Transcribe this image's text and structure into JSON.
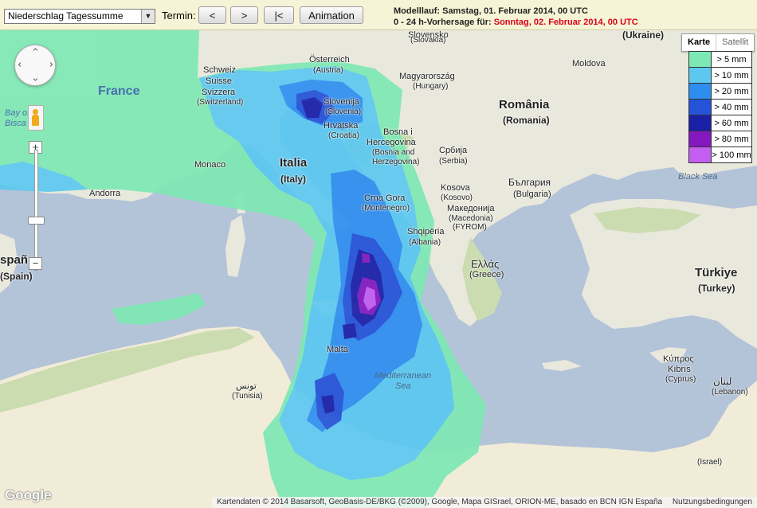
{
  "toolbar": {
    "product_select": "Niederschlag Tagessumme",
    "termin_label": "Termin:",
    "prev_button": "<",
    "next_button": ">",
    "first_button": "|<",
    "animation_button": "Animation",
    "modellauf_label": "Modelllauf: Samstag, 01. Februar 2014, 00 UTC",
    "forecast_prefix": "0 - 24 h-Vorhersage für:",
    "forecast_date": "Sonntag, 02. Februar 2014, 00 UTC",
    "colors": {
      "background": "#f6f4d6",
      "forecast_date": "#d8001a"
    }
  },
  "map_type": {
    "map_button": "Karte",
    "satellite_button": "Satellit",
    "selected": "Karte"
  },
  "legend": [
    {
      "label": "> 5 mm",
      "color": "#7ee8b4"
    },
    {
      "label": "> 10 mm",
      "color": "#5cc8f0"
    },
    {
      "label": "> 20 mm",
      "color": "#2e8ef0"
    },
    {
      "label": "> 40 mm",
      "color": "#2452d8"
    },
    {
      "label": "> 60 mm",
      "color": "#1a1fa8"
    },
    {
      "label": "> 80 mm",
      "color": "#8418c0"
    },
    {
      "label": "> 100 mm",
      "color": "#c45ef0"
    }
  ],
  "map": {
    "colors": {
      "sea": "#b3c3d8",
      "land": "#e9e8dc",
      "green": "#cbdcb0",
      "sand": "#f1ecd8"
    },
    "labels": {
      "france": "France",
      "bay_of_biscay_1": "Bay of",
      "bay_of_biscay_2": "Bisca",
      "schweiz": "Schweiz",
      "suisse": "Suisse",
      "svizzera": "Svizzera",
      "switzerland": "(Switzerland)",
      "osterreich": "Österreich",
      "austria": "(Austria)",
      "slovensko": "Slovensko",
      "slovakia": "(Slovakia)",
      "ukraine": "(Ukraine)",
      "magyarorszag": "Magyarország",
      "hungary": "(Hungary)",
      "moldova": "Moldova",
      "slovenija": "Slovenija",
      "slovenia": "(Slovenia)",
      "hrvatska": "Hrvatska",
      "croatia": "(Croatia)",
      "bosna": "Bosna i",
      "hercegovina": "Hercegovina",
      "bosnia": "(Bosnia and",
      "herzegovina": "Herzegovina)",
      "romania": "România",
      "romania_en": "(Romania)",
      "srbija": "Србија",
      "serbia": "(Serbia)",
      "monaco": "Monaco",
      "andorra": "Andorra",
      "italia": "Italia",
      "italy": "(Italy)",
      "crna_gora": "Crna Gora",
      "montenegro": "(Montenegro)",
      "kosova": "Kosova",
      "kosovo": "(Kosovo)",
      "bulgaria": "България",
      "bulgaria_en": "(Bulgaria)",
      "black_sea": "Black Sea",
      "makedonija": "Македонија",
      "macedonia": "(Macedonia)",
      "fyrom": "(FYROM)",
      "shqiperia": "Shqipëria",
      "albania": "(Albania)",
      "espana": "spañ",
      "spain": "(Spain)",
      "ellas": "Ελλάς",
      "greece": "(Greece)",
      "turkiye": "Türkiye",
      "turkey": "(Turkey)",
      "malta": "Malta",
      "med_sea_1": "Mediterranean",
      "med_sea_2": "Sea",
      "tunis": "تونس",
      "tunisia": "(Tunisia)",
      "cyprus_gr": "Κύπρος",
      "cyprus_tr": "Kıbrıs",
      "cyprus": "(Cyprus)",
      "lebanon_ar": "لبنان",
      "lebanon": "(Lebanon)",
      "israel": "(Israel)"
    }
  },
  "google_logo": "Google",
  "attribution": "Kartendaten © 2014 Basarsoft, GeoBasis-DE/BKG (©2009), Google, Mapa GISrael, ORION-ME, basado en BCN IGN España",
  "terms": "Nutzungsbedingungen"
}
